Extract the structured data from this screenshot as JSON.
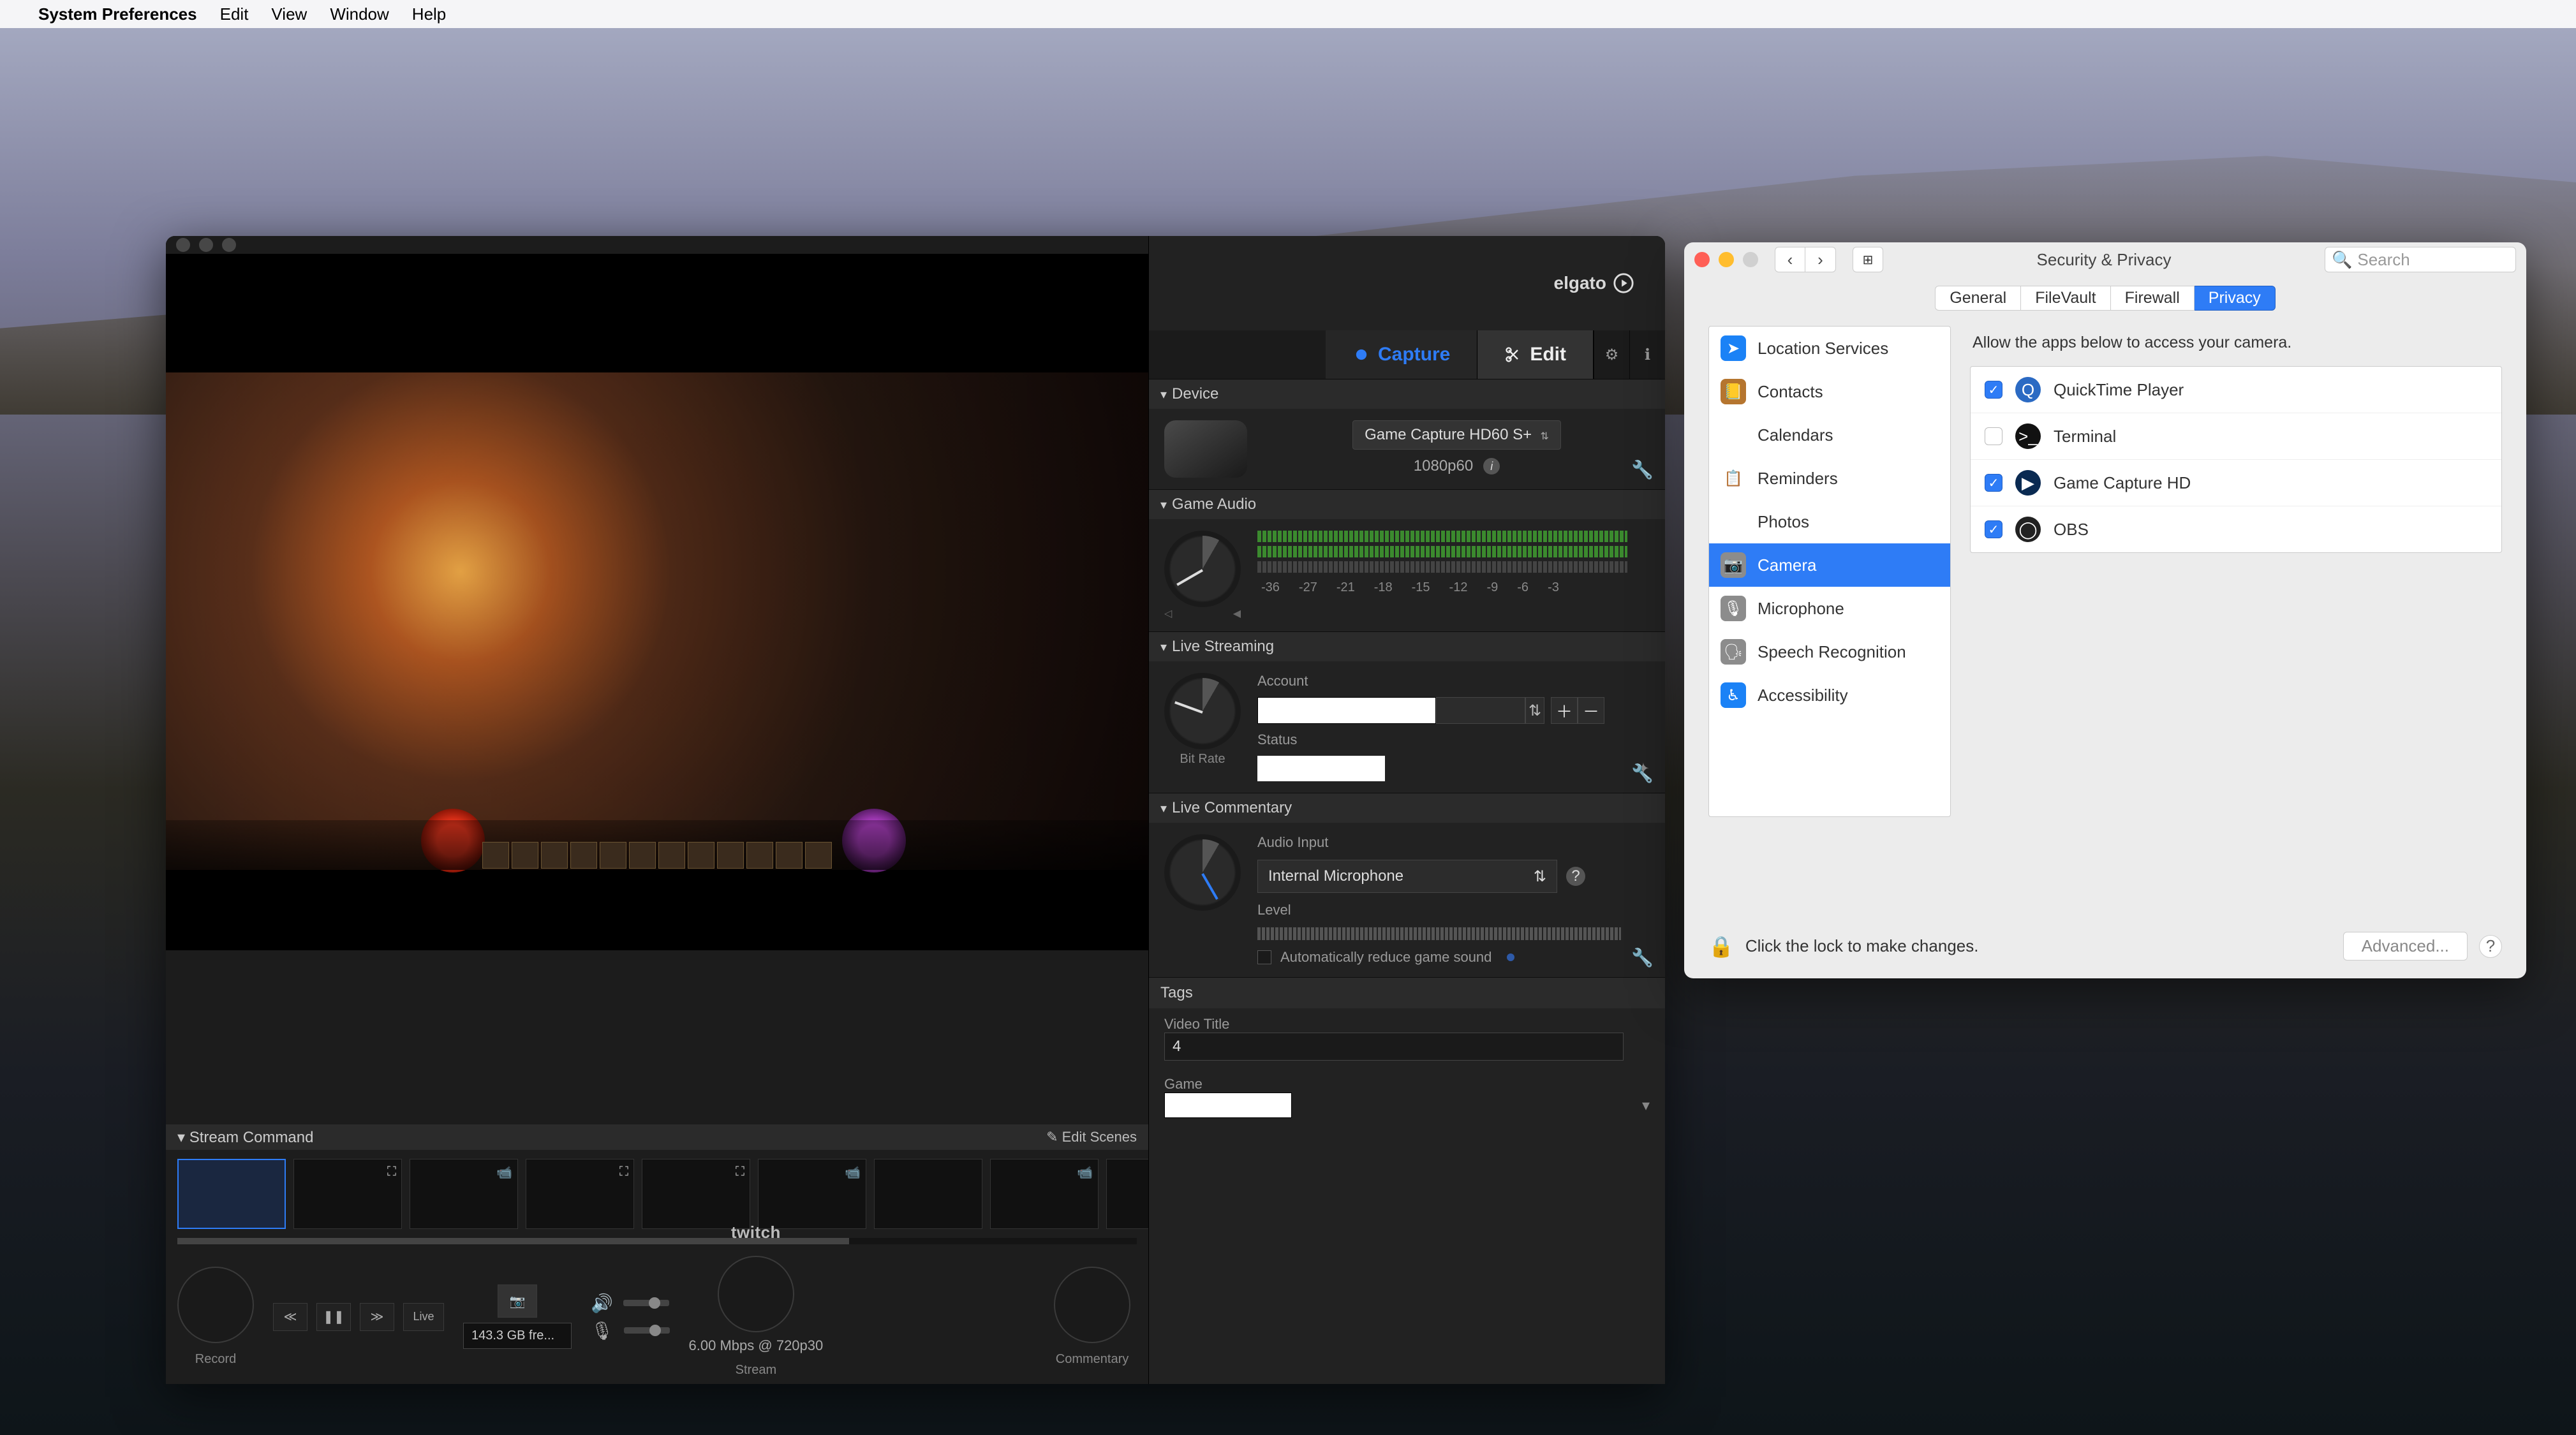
{
  "menubar": {
    "app": "System Preferences",
    "items": [
      "Edit",
      "View",
      "Window",
      "Help"
    ]
  },
  "app_window": {
    "brand": "elgato",
    "tabs": {
      "capture": "Capture",
      "edit": "Edit"
    },
    "device": {
      "section": "Device",
      "name": "Game Capture HD60 S+",
      "resolution": "1080p60"
    },
    "gameaudio": {
      "section": "Game Audio",
      "scale": [
        "-36",
        "-27",
        "-21",
        "-18",
        "-15",
        "-12",
        "-9",
        "-6",
        "-3"
      ]
    },
    "livestreaming": {
      "section": "Live Streaming",
      "account_label": "Account",
      "status_label": "Status",
      "bitrate_label": "Bit Rate"
    },
    "livecommentary": {
      "section": "Live Commentary",
      "audio_input_label": "Audio Input",
      "audio_input_value": "Internal Microphone",
      "level_label": "Level",
      "auto_reduce": "Automatically reduce game sound"
    },
    "tags": {
      "section": "Tags",
      "video_title_label": "Video Title",
      "video_title_value": "4",
      "game_label": "Game"
    },
    "footer": {
      "streamcmd": "Stream Command",
      "editscenes": "Edit Scenes",
      "live": "Live",
      "storage": "143.3 GB fre...",
      "record": "Record",
      "stream": "Stream",
      "commentary": "Commentary",
      "twitch": "twitch",
      "bitrate": "6.00 Mbps @ 720p30"
    }
  },
  "prefs": {
    "title": "Security & Privacy",
    "search_placeholder": "Search",
    "tabs": [
      "General",
      "FileVault",
      "Firewall",
      "Privacy"
    ],
    "services": [
      {
        "label": "Location Services",
        "c": "#1b82f6",
        "g": "➤"
      },
      {
        "label": "Contacts",
        "c": "#b5752f",
        "g": "📒"
      },
      {
        "label": "Calendars",
        "c": "#fff",
        "g": "🗓"
      },
      {
        "label": "Reminders",
        "c": "#fff",
        "g": "📋"
      },
      {
        "label": "Photos",
        "c": "#fff",
        "g": "✿"
      },
      {
        "label": "Camera",
        "c": "#8c8c8c",
        "g": "📷"
      },
      {
        "label": "Microphone",
        "c": "#8c8c8c",
        "g": "🎙"
      },
      {
        "label": "Speech Recognition",
        "c": "#8c8c8c",
        "g": "🗣"
      },
      {
        "label": "Accessibility",
        "c": "#1b82f6",
        "g": "♿︎"
      }
    ],
    "selected_service": "Camera",
    "hint": "Allow the apps below to access your camera.",
    "apps": [
      {
        "label": "QuickTime Player",
        "on": true,
        "c": "#2b6ac3",
        "g": "Q"
      },
      {
        "label": "Terminal",
        "on": false,
        "c": "#111",
        "g": ">_"
      },
      {
        "label": "Game Capture HD",
        "on": true,
        "c": "#0a2a52",
        "g": "▶"
      },
      {
        "label": "OBS",
        "on": true,
        "c": "#222",
        "g": "◯"
      }
    ],
    "lock_text": "Click the lock to make changes.",
    "advanced": "Advanced..."
  }
}
